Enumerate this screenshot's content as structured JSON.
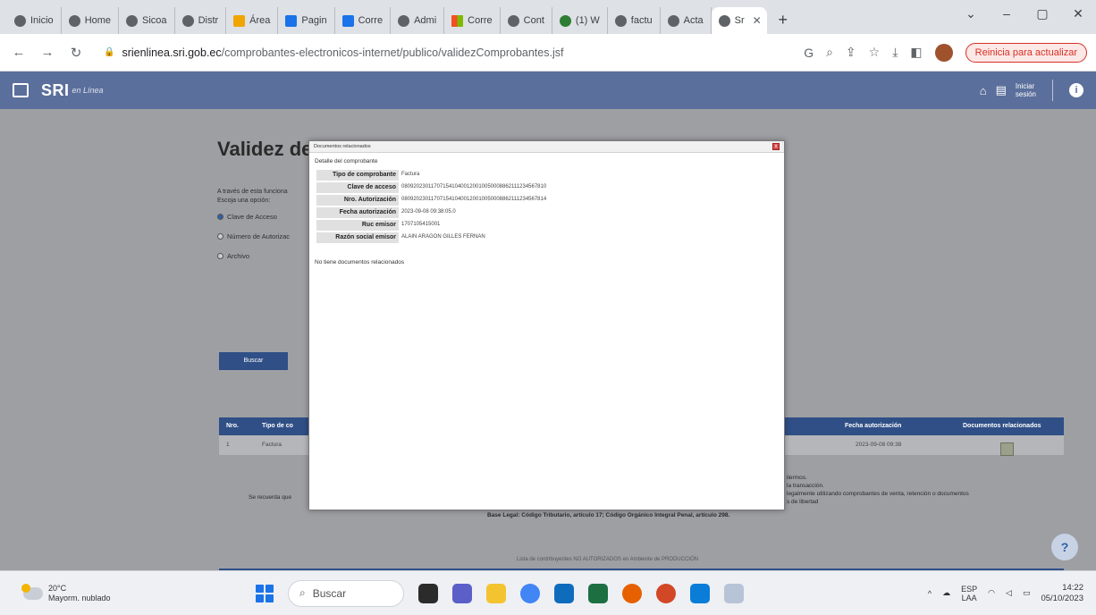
{
  "browser": {
    "tabs": [
      {
        "label": "Inicio",
        "fav": ""
      },
      {
        "label": "Home",
        "fav": ""
      },
      {
        "label": "Sicoa",
        "fav": ""
      },
      {
        "label": "Distr",
        "fav": ""
      },
      {
        "label": "Área",
        "fav": "yellow"
      },
      {
        "label": "Pagin",
        "fav": "blue"
      },
      {
        "label": "Corre",
        "fav": "blue"
      },
      {
        "label": "Admi",
        "fav": ""
      },
      {
        "label": "Corre",
        "fav": "ms"
      },
      {
        "label": "Cont",
        "fav": ""
      },
      {
        "label": "(1) W",
        "fav": "green"
      },
      {
        "label": "factu",
        "fav": ""
      },
      {
        "label": "Acta",
        "fav": ""
      }
    ],
    "active_tab_label": "Sr",
    "url_host": "srienlinea.sri.gob.ec",
    "url_path": "/comprobantes-electronicos-internet/publico/validezComprobantes.jsf",
    "update_button": "Reinicia para actualizar"
  },
  "sri_header": {
    "logo": "SRI",
    "logo_sub": "en Línea",
    "login_line1": "Iniciar",
    "login_line2": "sesión"
  },
  "page": {
    "title": "Validez de",
    "desc_line1": "A través de esta funciona",
    "desc_line2": "Escoja una opción:",
    "radios": [
      "Clave de Acceso",
      "Número de Autorizac",
      "Archivo"
    ],
    "search_button": "Buscar",
    "table_headers": {
      "nro": "Nro.",
      "tipo": "Tipo de co",
      "fecha": "Fecha autorización",
      "docs": "Documentos relacionados"
    },
    "table_row": {
      "nro": "1",
      "tipo": "Factura",
      "fecha": "2023-09-08 09:38"
    },
    "notes": [
      "ilermos.",
      "la transacción.",
      "legalmente utilizando comprobantes de venta, retención o documentos",
      "s de libertad"
    ],
    "recuerda": "Se recuerda que",
    "base_legal": "Base Legal: Código Tributario, artículo 17; Código Orgánico Integral Penal, artículo 298.",
    "footer_note": "Lista de contribuyentes NO AUTORIZADOS en Ambiente de PRODUCCIÓN"
  },
  "modal": {
    "title": "Documentos relacionados",
    "detail_label": "Detalle del comprobante",
    "rows": [
      {
        "label": "Tipo de comprobante",
        "value": "Factura"
      },
      {
        "label": "Clave de acceso",
        "value": "0809202301170715410400120010050008862111234567810"
      },
      {
        "label": "Nro. Autorización",
        "value": "0809202301170715410400120010050008862111234567814"
      },
      {
        "label": "Fecha autorización",
        "value": "2023-09-08 09:38:05.0"
      },
      {
        "label": "Ruc emisor",
        "value": "1707105415001"
      },
      {
        "label": "Razón social emisor",
        "value": "ALAIN ARAGON GILLES FERNAN"
      }
    ],
    "no_docs": "No tiene documentos relacionados"
  },
  "taskbar": {
    "temperature": "20°C",
    "weather": "Mayorm. nublado",
    "search": "Buscar",
    "lang1": "ESP",
    "lang2": "LAA",
    "time": "14:22",
    "date": "05/10/2023"
  }
}
